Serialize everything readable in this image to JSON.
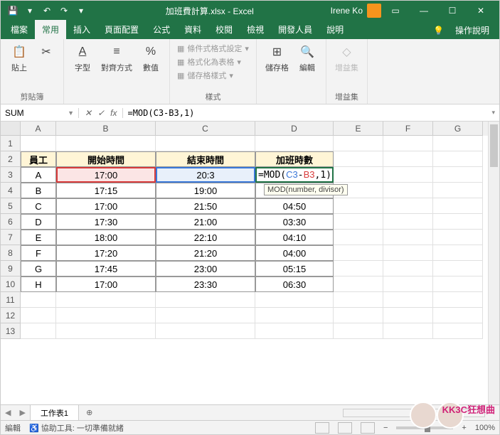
{
  "titlebar": {
    "filename": "加班費計算.xlsx - Excel",
    "user": "Irene Ko"
  },
  "tabs": {
    "file": "檔案",
    "home": "常用",
    "insert": "插入",
    "layout": "頁面配置",
    "formulas": "公式",
    "data": "資料",
    "review": "校閱",
    "view": "檢視",
    "dev": "開發人員",
    "help": "說明",
    "tellme": "操作說明"
  },
  "ribbon": {
    "paste": "貼上",
    "clipboard": "剪貼簿",
    "font": "字型",
    "align": "對齊方式",
    "number": "數值",
    "condfmt": "條件式格式設定",
    "astable": "格式化為表格",
    "cellstyle": "儲存格樣式",
    "styles": "樣式",
    "cells": "儲存格",
    "editing": "編輯",
    "addins_label": "增益集",
    "addins_btn": "增益集"
  },
  "namebox": "SUM",
  "formula": "=MOD(C3-B3,1)",
  "tooltip": "MOD(number, divisor)",
  "cols": [
    "A",
    "B",
    "C",
    "D",
    "E",
    "F",
    "G"
  ],
  "headers": {
    "emp": "員工",
    "start": "開始時間",
    "end": "結束時間",
    "ot": "加班時數"
  },
  "rows": [
    {
      "emp": "A",
      "start": "17:00",
      "end": "20:3",
      "ot": ""
    },
    {
      "emp": "B",
      "start": "17:15",
      "end": "19:00",
      "ot": ""
    },
    {
      "emp": "C",
      "start": "17:00",
      "end": "21:50",
      "ot": "04:50"
    },
    {
      "emp": "D",
      "start": "17:30",
      "end": "21:00",
      "ot": "03:30"
    },
    {
      "emp": "E",
      "start": "18:00",
      "end": "22:10",
      "ot": "04:10"
    },
    {
      "emp": "F",
      "start": "17:20",
      "end": "21:20",
      "ot": "04:00"
    },
    {
      "emp": "G",
      "start": "17:45",
      "end": "23:00",
      "ot": "05:15"
    },
    {
      "emp": "H",
      "start": "17:00",
      "end": "23:30",
      "ot": "06:30"
    }
  ],
  "edit_formula": {
    "pre": "=MOD(",
    "ref1": "C3",
    "mid": "-",
    "ref2": "B3",
    "post": ",1)"
  },
  "sheet_tab": "工作表1",
  "status": {
    "mode": "編輯",
    "acc": "協助工具: 一切準備就緒",
    "zoom": "100%"
  },
  "colwidths": {
    "A": 50,
    "B": 140,
    "C": 140,
    "D": 110,
    "E": 70,
    "F": 70,
    "G": 70
  },
  "watermark": "KK3C狂想曲"
}
